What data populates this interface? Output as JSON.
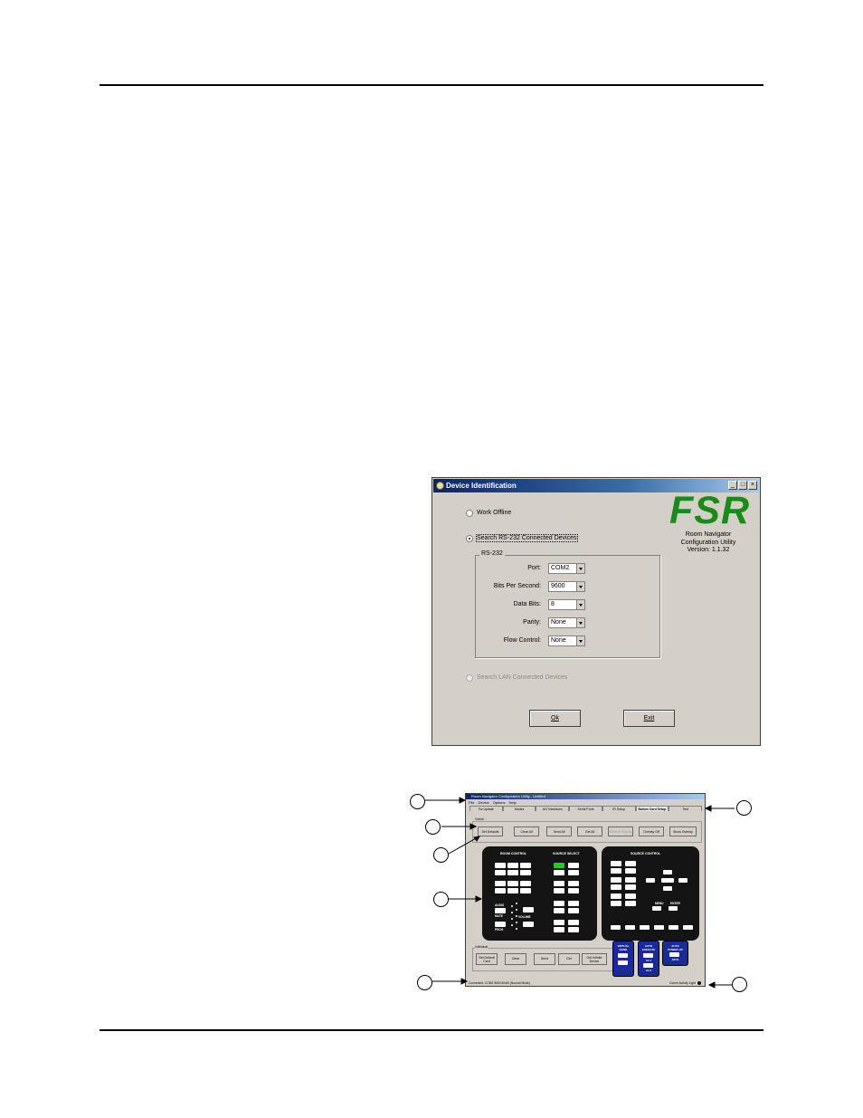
{
  "dialog": {
    "title": "Device Identification",
    "options": {
      "work_offline": "Work Offline",
      "search_rs232": "Search RS-232 Connected Devices",
      "search_lan": "Search LAN Connected Devices"
    },
    "group_label": "RS-232",
    "fields": [
      {
        "label": "Port:",
        "value": "COM2"
      },
      {
        "label": "Bits Per Second:",
        "value": "9600"
      },
      {
        "label": "Data Bits:",
        "value": "8"
      },
      {
        "label": "Parity:",
        "value": "None"
      },
      {
        "label": "Flow Control:",
        "value": "None"
      }
    ],
    "logo": "FSR",
    "product_line1": "Room Navigator",
    "product_line2": "Configuration Utility",
    "version": "Version: 1.1.32",
    "ok_label": "Ok",
    "exit_label": "Exit",
    "window_buttons": [
      "_",
      "□",
      "×"
    ]
  },
  "app": {
    "title": "Room Navigator Configuration Utility - Untitled",
    "menu": [
      "File",
      "Device",
      "Options",
      "Help"
    ],
    "tabs": [
      "Fw Update",
      "Modes",
      "A/V Interfaces",
      "Serial Ports",
      "IR Setup",
      "Button Card Setup",
      "Test"
    ],
    "selected_tab": 5,
    "global_label": "Global",
    "global_buttons": [
      "Set Defaults",
      "Clear All",
      "Send All",
      "Get All",
      "Refresh Display",
      "Overlay Off",
      "Show Overlay"
    ],
    "room_control": "ROOM CONTROL",
    "source_select": "SOURCE SELECT",
    "source_control": "SOURCE CONTROL",
    "labels": {
      "audio": "AUDIO",
      "mute": "MUTE",
      "prog": "PROG",
      "volume": "VOLUME",
      "menu": "MENU",
      "enter": "ENTER"
    },
    "individual_label": "Individual",
    "individual_buttons": [
      "Set Default Card",
      "Clear",
      "Send",
      "Get",
      "Get Infinite Device"
    ],
    "blue_panels": {
      "virtual": [
        "VIRTUAL",
        "BANK"
      ],
      "auto_execute": [
        "AUTO",
        "EXECUTE"
      ],
      "a1": "A1.1",
      "a2": "A1.2",
      "auto_power": [
        "AUTO",
        "POWER-UP"
      ],
      "apu": "APU1"
    },
    "status_left": "Connected: COM2 9600 8/N/N (Normal Mode)",
    "status_right": "Comm Activity Light"
  }
}
